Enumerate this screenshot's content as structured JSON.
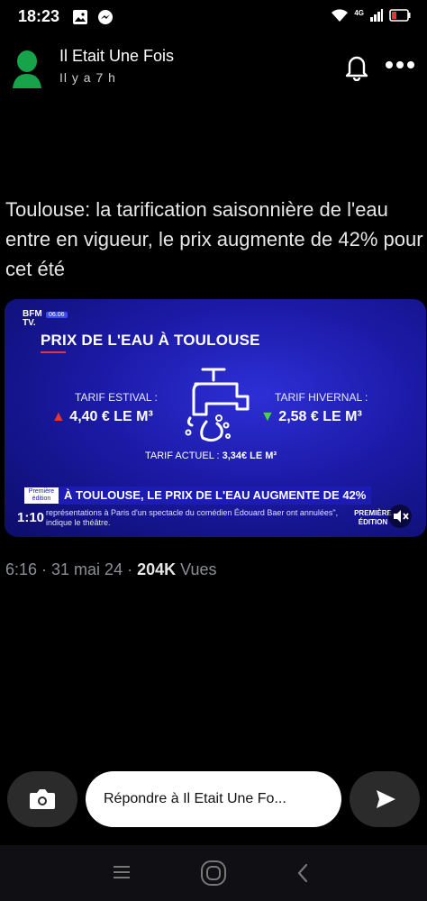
{
  "status_bar": {
    "time": "18:23",
    "network": "4G",
    "icons": [
      "image-icon",
      "messenger-icon",
      "wifi-icon",
      "signal-icon",
      "battery-icon"
    ]
  },
  "story": {
    "author": "Il Etait Une Fois",
    "time_ago": "Il y a 7 h",
    "icons": [
      "avatar-icon",
      "bell-icon",
      "more-icon"
    ]
  },
  "tweet": {
    "text": "Toulouse: la tarification saisonnière de l'eau entre en vigueur, le prix augmente de 42% pour cet été",
    "meta_prefix": "6:16 · 31 mai 24 · ",
    "views_count": "204K",
    "views_label": " Vues"
  },
  "video": {
    "channel": "BFM TV.",
    "date_tag": "06.06",
    "headline": "PRIX DE L'EAU À TOULOUSE",
    "tarif_estival_label": "TARIF ESTIVAL :",
    "tarif_estival_value": "4,40 € LE M³",
    "tarif_hivernal_label": "TARIF HIVERNAL :",
    "tarif_hivernal_value": "2,58 € LE M³",
    "tarif_actuel_label": "TARIF ACTUEL : ",
    "tarif_actuel_value": "3,34€ LE M³",
    "banner_tag": "Première édition",
    "banner_text": "À TOULOUSE, LE PRIX DE L'EAU AUGMENTE DE 42%",
    "elapsed": "1:10",
    "ticker": "représentations à Paris d'un spectacle du comédien Édouard Baer ont annulées\", indique le théâtre.",
    "edition_label": "PREMIÈRE ÉDITION"
  },
  "reply_bar": {
    "placeholder": "Répondre à Il Etait Une Fo...",
    "icons": [
      "camera-icon",
      "send-icon"
    ]
  },
  "colors": {
    "background": "#000000",
    "video_blue": "#1b1aa6",
    "up_red": "#e53535",
    "down_green": "#4bd14b",
    "avatar_green": "#16a34a"
  }
}
